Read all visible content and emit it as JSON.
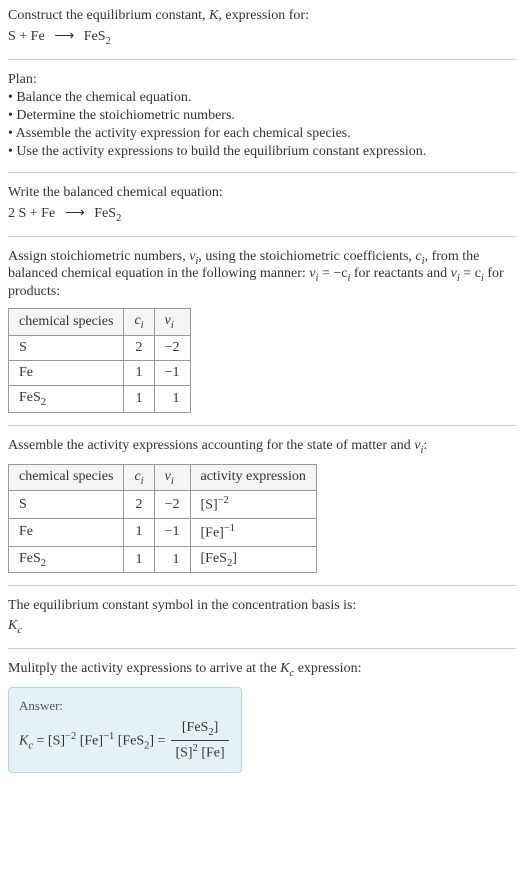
{
  "header": {
    "prompt": "Construct the equilibrium constant, K, expression for:",
    "equation_left": "S + Fe",
    "equation_arrow": "⟶",
    "equation_right": "FeS",
    "equation_right_sub": "2"
  },
  "plan": {
    "title": "Plan:",
    "items": [
      "• Balance the chemical equation.",
      "• Determine the stoichiometric numbers.",
      "• Assemble the activity expression for each chemical species.",
      "• Use the activity expressions to build the equilibrium constant expression."
    ]
  },
  "balanced": {
    "prompt": "Write the balanced chemical equation:",
    "left": "2 S + Fe",
    "arrow": "⟶",
    "right": "FeS",
    "right_sub": "2"
  },
  "stoich": {
    "text_a": "Assign stoichiometric numbers, ",
    "nu": "ν",
    "sub_i": "i",
    "text_b": ", using the stoichiometric coefficients, ",
    "c": "c",
    "text_c": ", from the balanced chemical equation in the following manner: ",
    "eq1": "ν",
    "eq1b": " = −c",
    "text_d": " for reactants and ",
    "eq2": "ν",
    "eq2b": " = c",
    "text_e": " for products:",
    "table": {
      "headers": [
        "chemical species",
        "c",
        "ν"
      ],
      "header_sub": "i",
      "rows": [
        {
          "species": "S",
          "species_sub": "",
          "c": "2",
          "nu": "−2"
        },
        {
          "species": "Fe",
          "species_sub": "",
          "c": "1",
          "nu": "−1"
        },
        {
          "species": "FeS",
          "species_sub": "2",
          "c": "1",
          "nu": "1"
        }
      ]
    }
  },
  "activity": {
    "text_a": "Assemble the activity expressions accounting for the state of matter and ",
    "nu": "ν",
    "sub_i": "i",
    "text_b": ":",
    "table": {
      "headers": [
        "chemical species",
        "c",
        "ν",
        "activity expression"
      ],
      "header_sub": "i",
      "rows": [
        {
          "species": "S",
          "species_sub": "",
          "c": "2",
          "nu": "−2",
          "act_base": "[S]",
          "act_sup": "−2",
          "act_sub": ""
        },
        {
          "species": "Fe",
          "species_sub": "",
          "c": "1",
          "nu": "−1",
          "act_base": "[Fe]",
          "act_sup": "−1",
          "act_sub": ""
        },
        {
          "species": "FeS",
          "species_sub": "2",
          "c": "1",
          "nu": "1",
          "act_base": "[FeS",
          "act_sup": "",
          "act_sub": "2",
          "act_close": "]"
        }
      ]
    }
  },
  "symbol": {
    "text": "The equilibrium constant symbol in the concentration basis is:",
    "K": "K",
    "sub": "c"
  },
  "multiply": {
    "text_a": "Mulitply the activity expressions to arrive at the ",
    "K": "K",
    "sub": "c",
    "text_b": " expression:"
  },
  "answer": {
    "label": "Answer:",
    "K": "K",
    "sub_c": "c",
    "eq": " = ",
    "t1": "[S]",
    "t1_sup": "−2",
    "t2": " [Fe]",
    "t2_sup": "−1",
    "t3": " [FeS",
    "t3_sub": "2",
    "t3_close": "] = ",
    "num": "[FeS",
    "num_sub": "2",
    "num_close": "]",
    "den_a": "[S]",
    "den_a_sup": "2",
    "den_b": " [Fe]"
  }
}
